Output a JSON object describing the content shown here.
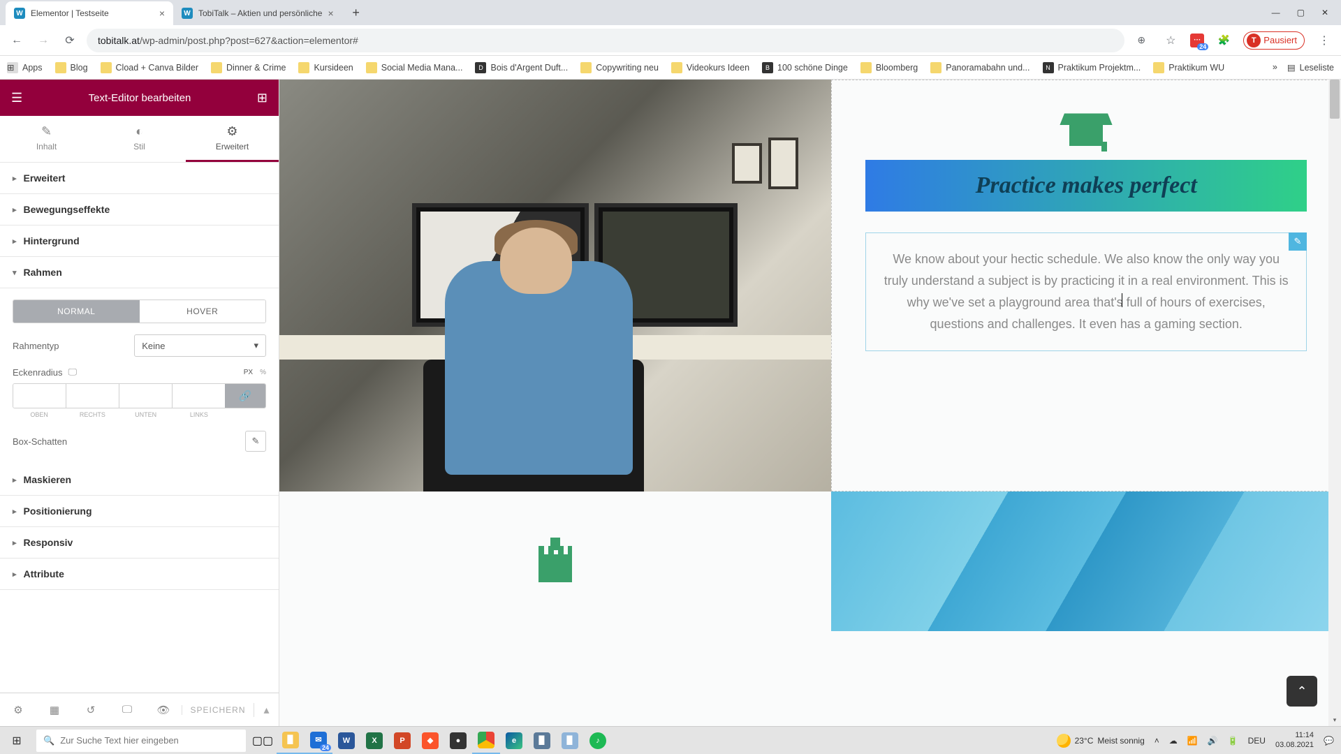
{
  "browser": {
    "tabs": [
      {
        "title": "Elementor | Testseite",
        "active": true
      },
      {
        "title": "TobiTalk – Aktien und persönliche",
        "active": false
      }
    ],
    "url_prefix": "tobitalk.at",
    "url_path": "/wp-admin/post.php?post=627&action=elementor#",
    "pausiert_label": "Pausiert",
    "pausiert_initial": "T",
    "bookmarks": [
      "Apps",
      "Blog",
      "Cload + Canva Bilder",
      "Dinner & Crime",
      "Kursideen",
      "Social Media Mana...",
      "Bois d'Argent Duft...",
      "Copywriting neu",
      "Videokurs Ideen",
      "100 schöne Dinge",
      "Bloomberg",
      "Panoramabahn und...",
      "Praktikum Projektm...",
      "Praktikum WU"
    ],
    "bookmarks_more": "»",
    "leseliste": "Leseliste"
  },
  "sidebar": {
    "title": "Text-Editor bearbeiten",
    "tabs": {
      "inhalt": "Inhalt",
      "stil": "Stil",
      "erweitert": "Erweitert"
    },
    "sections": {
      "erweitert": "Erweitert",
      "bewegung": "Bewegungseffekte",
      "hintergrund": "Hintergrund",
      "rahmen": "Rahmen",
      "maskieren": "Maskieren",
      "positionierung": "Positionierung",
      "responsiv": "Responsiv",
      "attribute": "Attribute"
    },
    "state": {
      "normal": "NORMAL",
      "hover": "HOVER"
    },
    "rahmentyp_label": "Rahmentyp",
    "rahmentyp_value": "Keine",
    "eckenradius_label": "Eckenradius",
    "unit_px": "PX",
    "unit_pct": "%",
    "sides": {
      "oben": "OBEN",
      "rechts": "RECHTS",
      "unten": "UNTEN",
      "links": "LINKS"
    },
    "boxschatten": "Box-Schatten",
    "footer": {
      "speichern": "SPEICHERN"
    }
  },
  "preview": {
    "heading": "Practice makes perfect",
    "paragraph": "We know about your hectic schedule. We also know the only way you truly understand a subject is by practicing it in a real environment. This is why we've set a playground area that's full of hours of exercises, questions and challenges. It even has a gaming section."
  },
  "taskbar": {
    "search_placeholder": "Zur Suche Text hier eingeben",
    "weather_temp": "23°C",
    "weather_text": "Meist sonnig",
    "lang": "DEU",
    "time": "11:14",
    "date": "03.08.2021",
    "outlook_badge": "24"
  }
}
